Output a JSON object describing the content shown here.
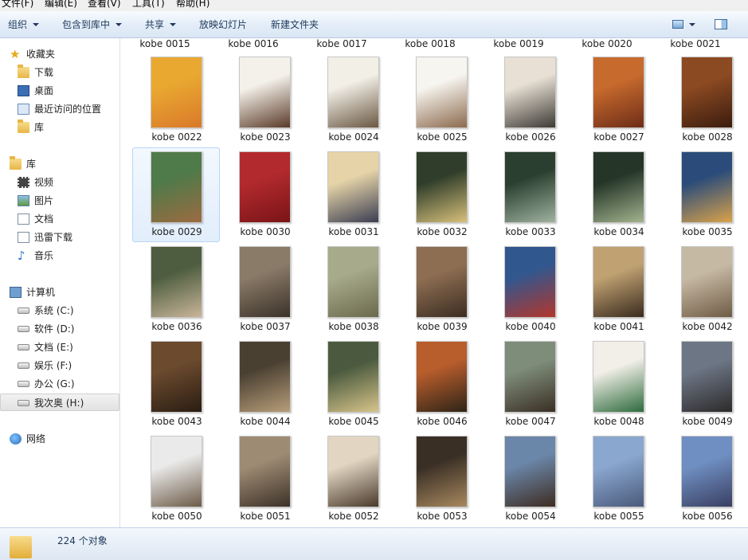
{
  "menubar": {
    "items": [
      "文件(F)",
      "编辑(E)",
      "查看(V)",
      "工具(T)",
      "帮助(H)"
    ]
  },
  "toolbar": {
    "organize": "组织",
    "include_in_library": "包含到库中",
    "share": "共享",
    "slideshow": "放映幻灯片",
    "new_folder": "新建文件夹",
    "view_icon": "view-options-icon",
    "preview_icon": "preview-pane-icon"
  },
  "navpane": {
    "favorites": {
      "label": "收藏夹",
      "items": [
        "下载",
        "桌面",
        "最近访问的位置",
        "库"
      ]
    },
    "libraries": {
      "label": "库",
      "items": [
        "视频",
        "图片",
        "文档",
        "迅雷下载",
        "音乐"
      ]
    },
    "computer": {
      "label": "计算机",
      "items": [
        "系统 (C:)",
        "软件 (D:)",
        "文档 (E:)",
        "娱乐 (F:)",
        "办公 (G:)",
        "我次奥 (H:)"
      ]
    },
    "network": {
      "label": "网络"
    }
  },
  "content": {
    "top_row_labels": [
      "kobe 0015",
      "kobe 0016",
      "kobe 0017",
      "kobe 0018",
      "kobe 0019",
      "kobe 0020",
      "kobe 0021"
    ],
    "files": [
      "kobe 0022",
      "kobe 0023",
      "kobe 0024",
      "kobe 0025",
      "kobe 0026",
      "kobe 0027",
      "kobe 0028",
      "kobe 0029",
      "kobe 0030",
      "kobe 0031",
      "kobe 0032",
      "kobe 0033",
      "kobe 0034",
      "kobe 0035",
      "kobe 0036",
      "kobe 0037",
      "kobe 0038",
      "kobe 0039",
      "kobe 0040",
      "kobe 0041",
      "kobe 0042",
      "kobe 0043",
      "kobe 0044",
      "kobe 0045",
      "kobe 0046",
      "kobe 0047",
      "kobe 0048",
      "kobe 0049",
      "kobe 0050",
      "kobe 0051",
      "kobe 0052",
      "kobe 0053",
      "kobe 0054",
      "kobe 0055",
      "kobe 0056"
    ],
    "selected_file": "kobe 0029"
  },
  "statusbar": {
    "count_text": "224 个对象"
  },
  "colors": {
    "toolbar_text": "#1e395b",
    "selection_border": "#b8d6fb"
  }
}
